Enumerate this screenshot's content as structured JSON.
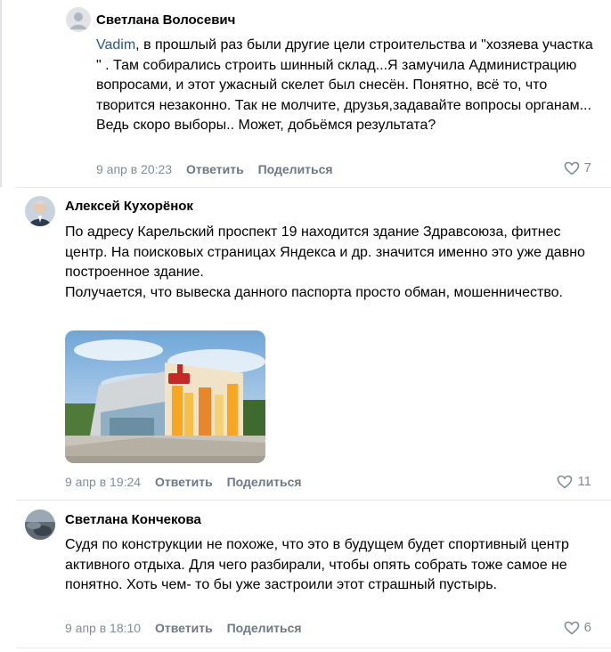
{
  "comments": [
    {
      "author": "Светлана Волосевич",
      "mention": "Vadim",
      "text": ", в прошлый раз были другие цели строительства и \"хозяева участка \" . Там собирались строить шинный склад...Я замучила Администрацию вопросами, и этот ужасный скелет был снесён. Понятно, всё то, что творится незаконно. Так не молчите, друзья,задавайте вопросы органам... Ведь скоро выборы.. Может, добьёмся результата?",
      "time": "9 апр в 20:23",
      "reply": "Ответить",
      "share": "Поделиться",
      "likes": "7"
    },
    {
      "author": "Алексей Кухорёнок",
      "text": "По адресу Карельский проспект 19 находится здание Здравсоюза, фитнес центр. На поисковых страницах Яндекса и др. значится именно это уже давно построенное здание.\nПолучается, что вывеска данного паспорта просто обман, мошенничество.",
      "photo_sign": "Здрав союз",
      "time": "9 апр в 19:24",
      "reply": "Ответить",
      "share": "Поделиться",
      "likes": "11"
    },
    {
      "author": "Светлана Кончекова",
      "text": "Судя по конструкции не похоже, что это в будущем будет спортивный центр активного отдыха. Для чего разбирали, чтобы опять собрать тоже самое не понятно. Хоть чем- то бы уже застроили этот страшный пустырь.",
      "time": "9 апр в 18:10",
      "reply": "Ответить",
      "share": "Поделиться",
      "likes": "6"
    }
  ],
  "colors": {
    "accent": "#2a5885",
    "meta": "#818c99",
    "action": "#6d7885"
  }
}
